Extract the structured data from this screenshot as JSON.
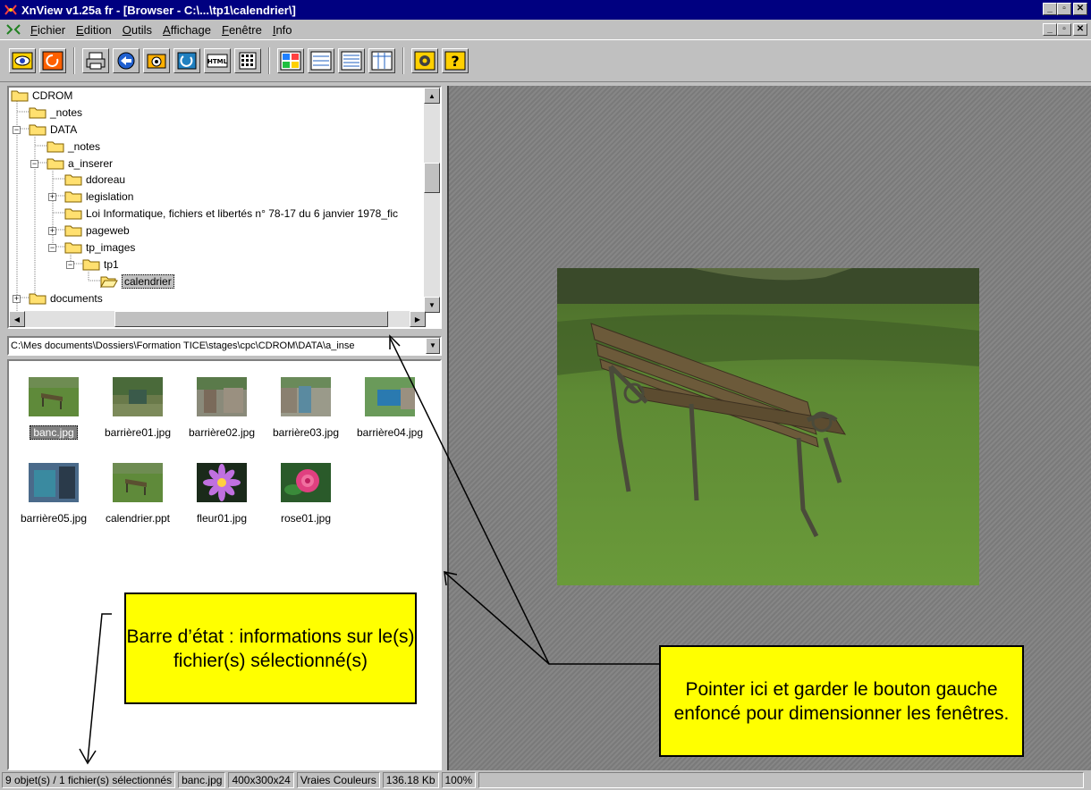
{
  "window": {
    "title": "XnView v1.25a fr - [Browser - C:\\...\\tp1\\calendrier\\]",
    "controls": [
      "_",
      "▫",
      "✕"
    ]
  },
  "menu": {
    "items": [
      {
        "first": "F",
        "rest": "ichier"
      },
      {
        "first": "E",
        "rest": "dition"
      },
      {
        "first": "O",
        "rest": "utils"
      },
      {
        "first": "A",
        "rest": "ffichage"
      },
      {
        "first": "F",
        "rest": "enêtre"
      },
      {
        "first": "I",
        "rest": "nfo"
      }
    ]
  },
  "toolbar": {
    "icons": [
      "view-icon",
      "refresh-icon",
      "print-icon",
      "convert-icon",
      "capture-icon",
      "slideshow-icon",
      "html-icon",
      "contact-sheet-icon",
      "large-icons-view-icon",
      "small-icons-view-icon",
      "list-view-icon",
      "details-view-icon",
      "settings-icon",
      "help-icon"
    ]
  },
  "tree": {
    "items": [
      {
        "label": "CDROM",
        "expander": ""
      },
      {
        "label": "_notes",
        "expander": ""
      },
      {
        "label": "DATA",
        "expander": "−"
      },
      {
        "label": "_notes",
        "expander": ""
      },
      {
        "label": "a_inserer",
        "expander": "−"
      },
      {
        "label": "ddoreau",
        "expander": ""
      },
      {
        "label": "legislation",
        "expander": "+"
      },
      {
        "label": "Loi Informatique, fichiers et libertés n° 78-17 du 6 janvier 1978_fic",
        "expander": ""
      },
      {
        "label": "pageweb",
        "expander": "+"
      },
      {
        "label": "tp_images",
        "expander": "−"
      },
      {
        "label": "tp1",
        "expander": "−"
      },
      {
        "label": "calendrier",
        "expander": ""
      },
      {
        "label": "documents",
        "expander": "+"
      }
    ]
  },
  "path": {
    "value": "C:\\Mes documents\\Dossiers\\Formation TICE\\stages\\cpc\\CDROM\\DATA\\a_inse"
  },
  "files": [
    {
      "name": "banc.jpg",
      "thumb": "bench",
      "selected": true
    },
    {
      "name": "barrière01.jpg",
      "thumb": "gate1"
    },
    {
      "name": "barrière02.jpg",
      "thumb": "gate2"
    },
    {
      "name": "barrière03.jpg",
      "thumb": "gate3"
    },
    {
      "name": "barrière04.jpg",
      "thumb": "gate4"
    },
    {
      "name": "barrière05.jpg",
      "thumb": "gate5"
    },
    {
      "name": "calendrier.ppt",
      "thumb": "bench"
    },
    {
      "name": "fleur01.jpg",
      "thumb": "flower"
    },
    {
      "name": "rose01.jpg",
      "thumb": "rose"
    }
  ],
  "callouts": {
    "status": "Barre d’état : informations sur le(s) fichier(s) sélectionné(s)",
    "resize": "Pointer ici et garder le bouton gauche enfoncé pour dimensionner les fenêtres."
  },
  "status": {
    "selection": "9 objet(s) / 1 fichier(s) sélectionnés",
    "filename": "banc.jpg",
    "dimensions": "400x300x24",
    "colors": "Vraies Couleurs",
    "size": "136.18 Kb",
    "zoom": "100%"
  }
}
